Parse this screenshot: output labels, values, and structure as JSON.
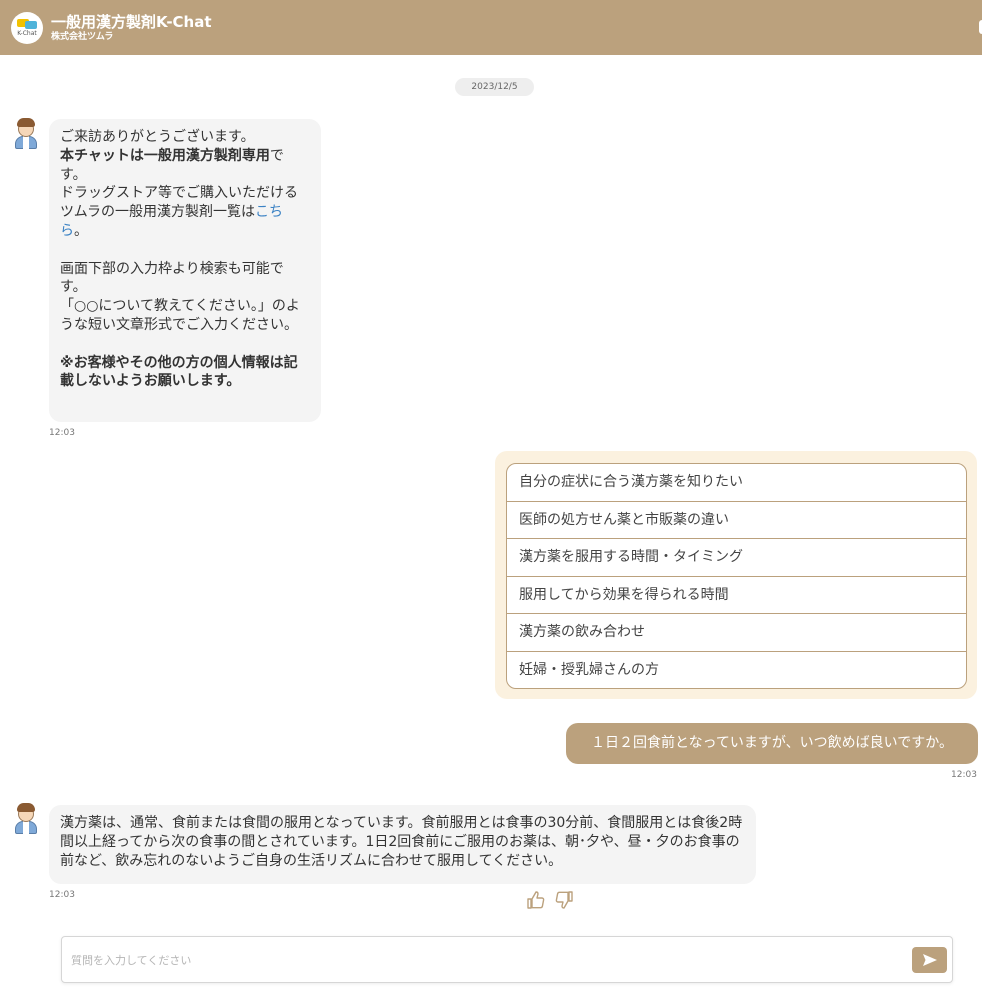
{
  "header": {
    "logo_text": "K-Chat",
    "title": "一般用漢方製剤K-Chat",
    "subtitle": "株式会社ツムラ"
  },
  "date_chip": "2023/12/5",
  "messages": {
    "welcome": {
      "line1": "ご来訪ありがとうございます。",
      "bold1": "本チャットは一般用漢方製剤専用",
      "line2_tail": "です。",
      "line3_pre": "ドラッグストア等でご購入いただけるツムラの一般用漢方製剤一覧は",
      "link": "こちら",
      "line3_post": "。",
      "line4": "画面下部の入力枠より検索も可能です。",
      "line5": "「○○について教えてください。」のような短い文章形式でご入力ください。",
      "bold2": "※お客様やその他の方の個人情報は記載しないようお願いします。",
      "time": "12:03"
    },
    "quick_replies": [
      "自分の症状に合う漢方薬を知りたい",
      "医師の処方せん薬と市販薬の違い",
      "漢方薬を服用する時間・タイミング",
      "服用してから効果を得られる時間",
      "漢方薬の飲み合わせ",
      "妊婦・授乳婦さんの方"
    ],
    "user_question": {
      "text": "１日２回食前となっていますが、いつ飲めば良いですか。",
      "time": "12:03"
    },
    "answer": {
      "text": "漢方薬は、通常、食前または食間の服用となっています。食前服用とは食事の30分前、食間服用とは食後2時間以上経ってから次の食事の間とされています。1日2回食前にご服用のお薬は、朝･夕や、昼・夕のお食事の前など、飲み忘れのないようご自身の生活リズムに合わせて服用してください。",
      "time": "12:03"
    }
  },
  "feedback": {
    "up_icon": "thumbs-up-icon",
    "down_icon": "thumbs-down-icon"
  },
  "input": {
    "placeholder": "質問を入力してください",
    "value": ""
  },
  "colors": {
    "brand": "#bba17d",
    "quick_bg": "#fbf1df",
    "bot_bubble": "#f4f4f4",
    "link": "#3b82c4"
  }
}
